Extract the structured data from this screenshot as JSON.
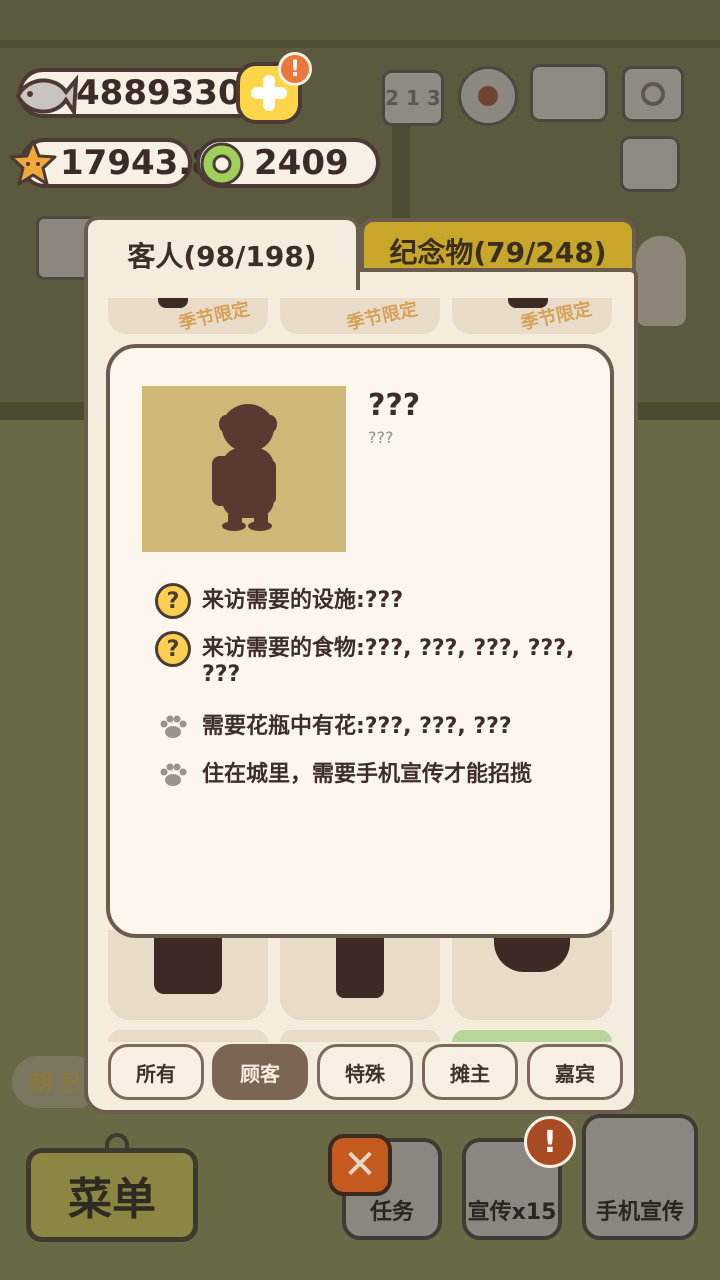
{
  "resources": {
    "fish": "4889330",
    "stars": "17943.8",
    "rings": "2409",
    "alert": "!"
  },
  "tabs": {
    "guests": "客人(98/198)",
    "souvenirs": "纪念物(79/248)"
  },
  "grid": {
    "seasonal_label": "季节限定"
  },
  "detail": {
    "name": "???",
    "subname": "???",
    "requirements": [
      {
        "icon": "question-icon",
        "text": "来访需要的设施:???"
      },
      {
        "icon": "question-icon",
        "text": "来访需要的食物:???, ???, ???, ???, ???"
      },
      {
        "icon": "paw-icon",
        "text": "需要花瓶中有花:???, ???, ???"
      },
      {
        "icon": "paw-icon",
        "text": "住在城里，需要手机宣传才能招揽"
      }
    ]
  },
  "filters": [
    "所有",
    "顾客",
    "特殊",
    "摊主",
    "嘉宾"
  ],
  "active_filter": "顾客",
  "bottom": {
    "menu": "菜单",
    "task": "任务",
    "promo": "宣传x15",
    "phone_promo": "手机宣传",
    "dawn": "朝 已"
  },
  "colors": {
    "accent_yellow": "#ffd54a",
    "tab_gold": "#c8a62a",
    "panel_bg": "#f4ecdc",
    "silhouette": "#5a3a30",
    "alert_orange": "#e9783b"
  }
}
